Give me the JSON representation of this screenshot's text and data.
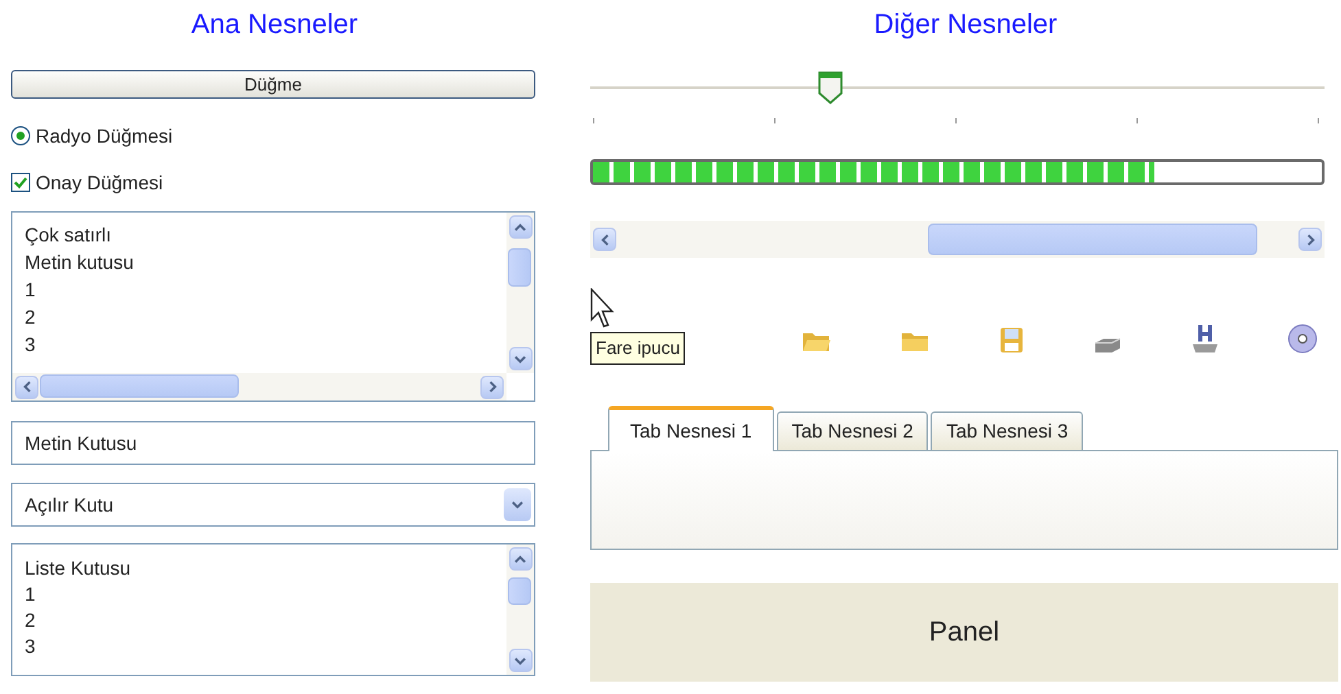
{
  "left": {
    "title": "Ana Nesneler",
    "button": "Düğme",
    "radio": {
      "label": "Radyo Düğmesi",
      "selected": true
    },
    "checkbox": {
      "label": "Onay Düğmesi",
      "checked": true
    },
    "multiline": {
      "lines": [
        "Çok satırlı",
        "Metin kutusu",
        "1",
        "2",
        "3"
      ]
    },
    "textbox": {
      "value": "Metin Kutusu"
    },
    "combobox": {
      "value": "Açılır Kutu"
    },
    "listbox": {
      "items": [
        "Liste Kutusu",
        "1",
        "2",
        "3"
      ]
    }
  },
  "right": {
    "title": "Diğer Nesneler",
    "slider": {
      "level": 0.33
    },
    "progress": {
      "level": 0.77
    },
    "tooltip": "Fare ipucu",
    "tabs": [
      {
        "label": "Tab Nesnesi 1",
        "selected": true
      },
      {
        "label": "Tab Nesnesi 2",
        "selected": false
      },
      {
        "label": "Tab Nesnesi 3",
        "selected": false
      }
    ],
    "panel": "Panel"
  }
}
